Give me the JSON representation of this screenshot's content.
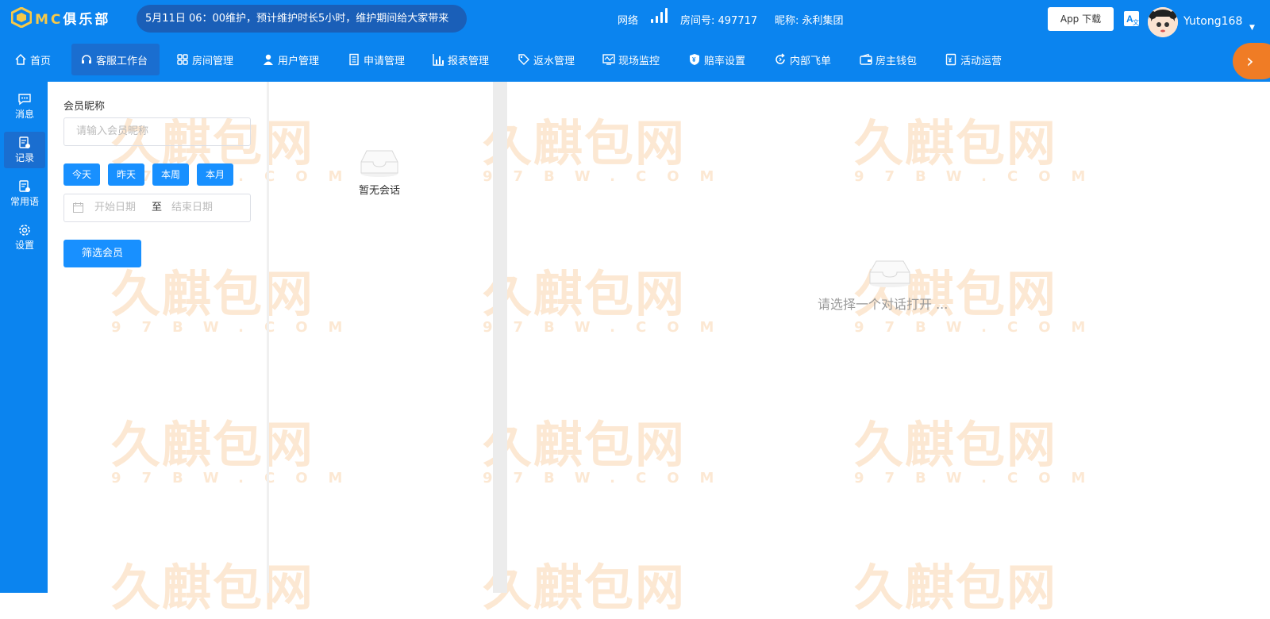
{
  "brand": {
    "title": "MC俱乐部",
    "accent": "#f7c948"
  },
  "colors": {
    "primary": "#0b84ef",
    "button": "#1890ff",
    "arrow": "#f07c25"
  },
  "announcement": "5月11日 06：00维护，预计维护时长5小时，维护期间给大家带来",
  "header": {
    "network_label": "网络",
    "room": "房间号: 497717",
    "nickname": "昵称: 永利集团",
    "app_download": "App 下载",
    "username": "Yutong168"
  },
  "nav": {
    "home": "首页",
    "cs": "客服工作台",
    "room": "房间管理",
    "user": "用户管理",
    "apply": "申请管理",
    "report": "报表管理",
    "rebate": "返水管理",
    "monitor": "现场监控",
    "odds": "赔率设置",
    "internal": "内部飞单",
    "wallet": "房主钱包",
    "activity": "活动运营"
  },
  "sidebar": {
    "message": "消息",
    "record": "记录",
    "phrases": "常用语",
    "settings": "设置"
  },
  "filter": {
    "member_label": "会员昵称",
    "member_placeholder": "请输入会员昵称",
    "today": "今天",
    "yesterday": "昨天",
    "this_week": "本周",
    "this_month": "本月",
    "start_date": "开始日期",
    "separator": "至",
    "end_date": "结束日期",
    "submit": "筛选会员"
  },
  "sessions": {
    "empty": "暂无会话"
  },
  "chat": {
    "empty": "请选择一个对话打开 ..."
  },
  "watermark": {
    "cn": "久麒包网",
    "en": "97BW.COM"
  }
}
